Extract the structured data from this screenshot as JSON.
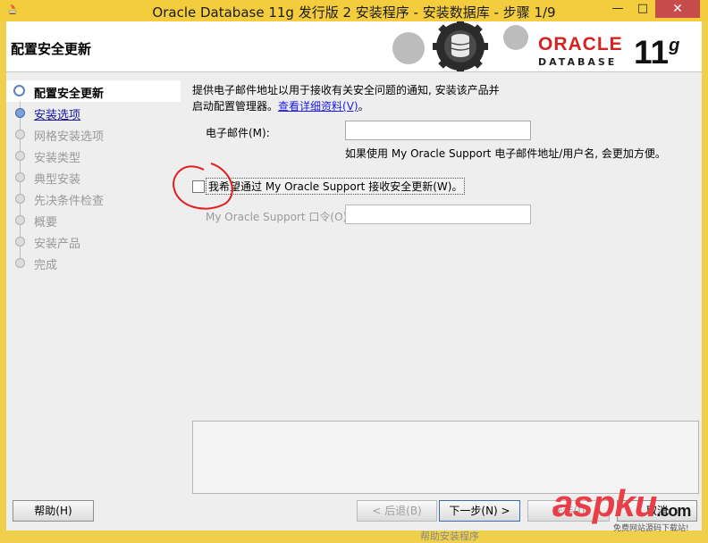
{
  "window": {
    "title": "Oracle Database 11g 发行版 2 安装程序 - 安装数据库 - 步骤 1/9",
    "min_symbol": "—",
    "max_symbol": "□",
    "close_symbol": "✕"
  },
  "banner": {
    "step_title": "配置安全更新",
    "logo_word": "ORACLE",
    "logo_sub": "DATABASE",
    "version": "11",
    "version_suffix": "g"
  },
  "nav": {
    "items": [
      {
        "label": "配置安全更新",
        "state": "current"
      },
      {
        "label": "安装选项",
        "state": "link"
      },
      {
        "label": "网格安装选项",
        "state": "disabled"
      },
      {
        "label": "安装类型",
        "state": "disabled"
      },
      {
        "label": "典型安装",
        "state": "disabled"
      },
      {
        "label": "先决条件检查",
        "state": "disabled"
      },
      {
        "label": "概要",
        "state": "disabled"
      },
      {
        "label": "安装产品",
        "state": "disabled"
      },
      {
        "label": "完成",
        "state": "disabled"
      }
    ]
  },
  "content": {
    "desc_line1": "提供电子邮件地址以用于接收有关安全问题的通知, 安装该产品并",
    "desc_line2": "启动配置管理器。",
    "desc_link": "查看详细资料(V)",
    "desc_end": "。",
    "email_label": "电子邮件(M):",
    "email_value": "",
    "email_hint": "如果使用 My Oracle Support 电子邮件地址/用户名, 会更加方便。",
    "checkbox_label": "我希望通过 My Oracle Support 接收安全更新(W)。",
    "checkbox_checked": false,
    "password_label": "My Oracle Support 口令(O):",
    "password_value": ""
  },
  "buttons": {
    "help": "帮助(H)",
    "back": "< 后退(B)",
    "next": "下一步(N) >",
    "install": "安装(I)",
    "cancel": "取消"
  },
  "watermark": {
    "text": "aspku",
    "suffix": ".com",
    "sub": "免费网站源码下载站!"
  },
  "footer": {
    "text": "帮助安装程序"
  },
  "colors": {
    "title_bar": "#f3cd3e",
    "close_button": "#c74b4b",
    "oracle_red": "#d42323",
    "link_blue": "#1a1aee",
    "annotation_red": "#e0201e"
  }
}
